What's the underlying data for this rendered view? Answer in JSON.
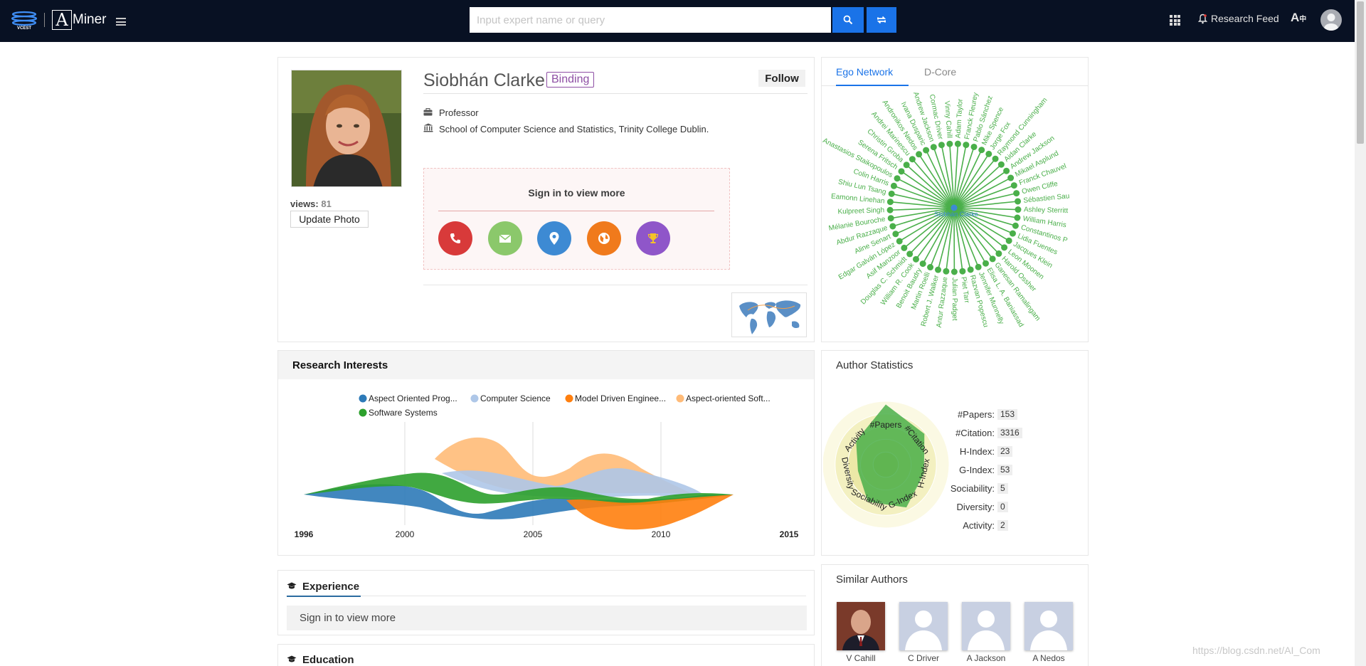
{
  "header": {
    "vcest_logo": "VCEST",
    "app_name": "Miner",
    "app_letter": "A",
    "search_placeholder": "Input expert name or query",
    "research_feed": "Research Feed",
    "icons": [
      "menu-icon",
      "search-icon",
      "swap-icon",
      "apps-icon",
      "bell-icon",
      "translate-icon",
      "user-icon"
    ]
  },
  "profile": {
    "name": "Siobhán Clarke",
    "binding_label": "Binding",
    "follow_label": "Follow",
    "views_label": "views:",
    "views_count": "81",
    "update_photo_label": "Update Photo",
    "position": "Professor",
    "affiliation": "School of Computer Science and Statistics, Trinity College Dublin.",
    "signin_label": "Sign in to view more",
    "contact_icons": [
      {
        "name": "phone-icon",
        "color": "#d83a3a"
      },
      {
        "name": "email-icon",
        "color": "#8bc86b"
      },
      {
        "name": "location-icon",
        "color": "#3d8ad3"
      },
      {
        "name": "globe-icon",
        "color": "#f07a1c"
      },
      {
        "name": "trophy-icon",
        "color": "#8f56c9"
      }
    ]
  },
  "ego_network": {
    "tabs": [
      "Ego Network",
      "D-Core"
    ],
    "active_tab": "Ego Network",
    "center_label": "Siobhán Clarke",
    "node_color": "#4aaf4a",
    "nodes": [
      "Adam Taylor",
      "Franck Fleurey",
      "Pablo Sánchez",
      "Mike Spence",
      "Jorge Fox",
      "Raymond Cunningham",
      "Aidan Clarke",
      "Andrew Jackson",
      "Mikael Asplund",
      "Franck Chauvel",
      "Owen Cliffe",
      "Sébastien Sau",
      "Ashley Sterritt",
      "William Harris",
      "Constantinos P",
      "Lidia Fuentes",
      "Jacques Klein",
      "Leon Moonen",
      "Harold Ossher",
      "Ganesan Ramalingam",
      "Elisa L. A. Baniassad",
      "Jennifer Munnelly",
      "Razvan Popescu",
      "Piet Tarr",
      "Julian Padget",
      "Antur Razzaque",
      "Robert J. Walker",
      "Martin Roelli",
      "Benoit Baudry",
      "William R. Cook",
      "Douglas C. Schmidt",
      "Asif Manzoor",
      "Edgar Galván López",
      "Aline Senart",
      "Abdur Razzaque",
      "Mélanie Bouroche",
      "Kulpreet Singh",
      "Eamonn Linehan",
      "Shiu Lun Tsang",
      "Colin Harris",
      "Anastasios Staikopoulos",
      "Serena Fritsch",
      "Christin Groba",
      "Andrei Marinescu",
      "Andronikos Nedos",
      "Ivana Dusparic",
      "Andrew Jackson",
      "Cormac Driver",
      "Vinny Cahill"
    ]
  },
  "research_interests": {
    "title": "Research Interests",
    "chart_data": {
      "type": "area",
      "x": [
        "1996",
        "2000",
        "2005",
        "2010",
        "2015"
      ],
      "series": [
        {
          "name": "Aspect Oriented Prog...",
          "color": "#2d7ab8"
        },
        {
          "name": "Computer Science",
          "color": "#aec7e8"
        },
        {
          "name": "Model Driven Enginee...",
          "color": "#ff7f0e"
        },
        {
          "name": "Aspect-oriented Soft...",
          "color": "#ffbb78"
        },
        {
          "name": "Software Systems",
          "color": "#2ca02c"
        }
      ]
    }
  },
  "author_statistics": {
    "title": "Author Statistics",
    "radar_axes": [
      "#Papers",
      "#Citation",
      "H-Index",
      "G-Index",
      "Sociability",
      "Diversity",
      "Activity"
    ],
    "stats": [
      {
        "label": "#Papers:",
        "value": "153"
      },
      {
        "label": "#Citation:",
        "value": "3316"
      },
      {
        "label": "H-Index:",
        "value": "23"
      },
      {
        "label": "G-Index:",
        "value": "53"
      },
      {
        "label": "Sociability:",
        "value": "5"
      },
      {
        "label": "Diversity:",
        "value": "0"
      },
      {
        "label": "Activity:",
        "value": "2"
      }
    ]
  },
  "experience": {
    "title": "Experience",
    "signin_label": "Sign in to view more"
  },
  "education": {
    "title": "Education"
  },
  "similar_authors": {
    "title": "Similar Authors",
    "authors": [
      {
        "name": "V Cahill",
        "has_photo": true
      },
      {
        "name": "C Driver",
        "has_photo": false
      },
      {
        "name": "A Jackson",
        "has_photo": false
      },
      {
        "name": "A Nedos",
        "has_photo": false
      }
    ]
  },
  "watermark": "https://blog.csdn.net/AI_Com"
}
